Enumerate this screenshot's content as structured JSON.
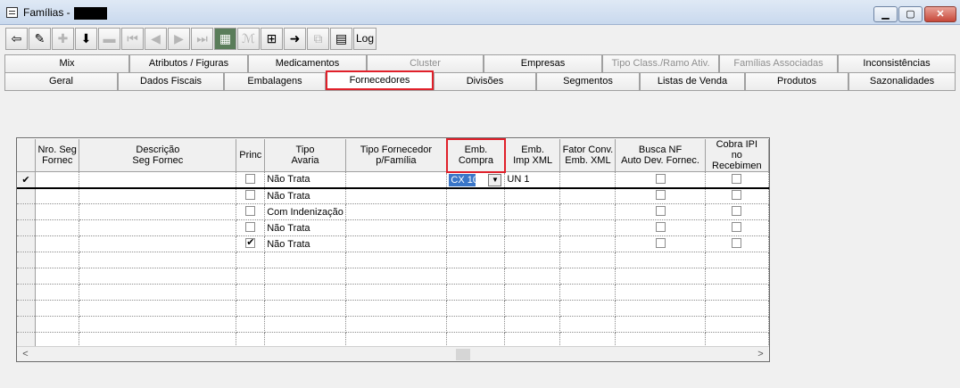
{
  "window": {
    "title": "Famílias -",
    "minimize": "▁",
    "maximize": "▢",
    "close": "✕"
  },
  "toolbar": {
    "log_label": "Log"
  },
  "tabs": {
    "row1": [
      "Mix",
      "Atributos / Figuras",
      "Medicamentos",
      "Cluster",
      "Empresas",
      "Tipo Class./Ramo Ativ.",
      "Famílias Associadas",
      "Inconsistências"
    ],
    "row2": [
      "Geral",
      "Dados Fiscais",
      "Embalagens",
      "Fornecedores",
      "Divisões",
      "Segmentos",
      "Listas de Venda",
      "Produtos",
      "Sazonalidades"
    ],
    "selected": "Fornecedores"
  },
  "grid": {
    "headers": [
      "Nro. Seg\nFornec",
      "Descrição\nSeg Fornec",
      "Princ",
      "Tipo\nAvaria",
      "Tipo Fornecedor\np/Família",
      "Emb.\nCompra",
      "Emb.\nImp XML",
      "Fator Conv.\nEmb. XML",
      "Busca NF\nAuto Dev. Fornec.",
      "Cobra IPI\nno Recebimen"
    ],
    "current_row_marker": "✔",
    "rows": [
      {
        "princ": false,
        "avaria": "Não Trata",
        "emb_compra": "CX  10",
        "emb_imp_xml": "UN  1"
      },
      {
        "princ": false,
        "avaria": "Não Trata"
      },
      {
        "princ": false,
        "avaria": "Com Indenização"
      },
      {
        "princ": false,
        "avaria": "Não Trata"
      },
      {
        "princ": true,
        "avaria": "Não Trata"
      }
    ],
    "empty_rows": 6
  },
  "scrollbar": {
    "left": "<",
    "right": ">"
  }
}
